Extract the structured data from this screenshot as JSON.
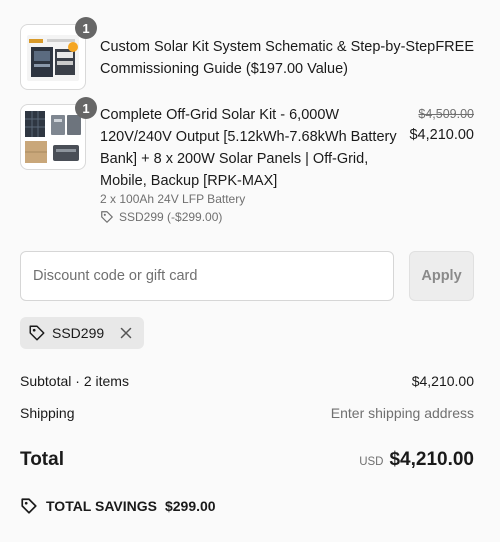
{
  "items": [
    {
      "quantity": "1",
      "title_line1": "Custom Solar Kit System Schematic & Step-by-Step",
      "title_line2": "Commissioning Guide ($197.00 Value)",
      "price": "FREE"
    },
    {
      "quantity": "1",
      "title_line1": "Complete Off-Grid Solar Kit - 6,000W",
      "title_line2": "120V/240V Output [5.12kWh-7.68kWh Battery",
      "title_line3": "Bank] + 8 x 200W Solar Panels | Off-Grid,",
      "title_line4": "Mobile, Backup [RPK-MAX]",
      "variant": "2 x 100Ah 24V LFP Battery",
      "discount": "SSD299 (-$299.00)",
      "compare_price": "$4,509.00",
      "price": "$4,210.00"
    }
  ],
  "discount": {
    "placeholder": "Discount code or gift card",
    "apply_label": "Apply",
    "applied_code": "SSD299"
  },
  "summary": {
    "subtotal_label": "Subtotal · 2 items",
    "subtotal_value": "$4,210.00",
    "shipping_label": "Shipping",
    "shipping_value": "Enter shipping address",
    "total_label": "Total",
    "currency": "USD",
    "total_value": "$4,210.00",
    "savings_label": "TOTAL SAVINGS",
    "savings_value": "$299.00"
  },
  "colors": {
    "badge": "#666666",
    "accent": "#f5a623"
  },
  "icons": {
    "tag": "tag-icon",
    "remove": "close-icon"
  }
}
